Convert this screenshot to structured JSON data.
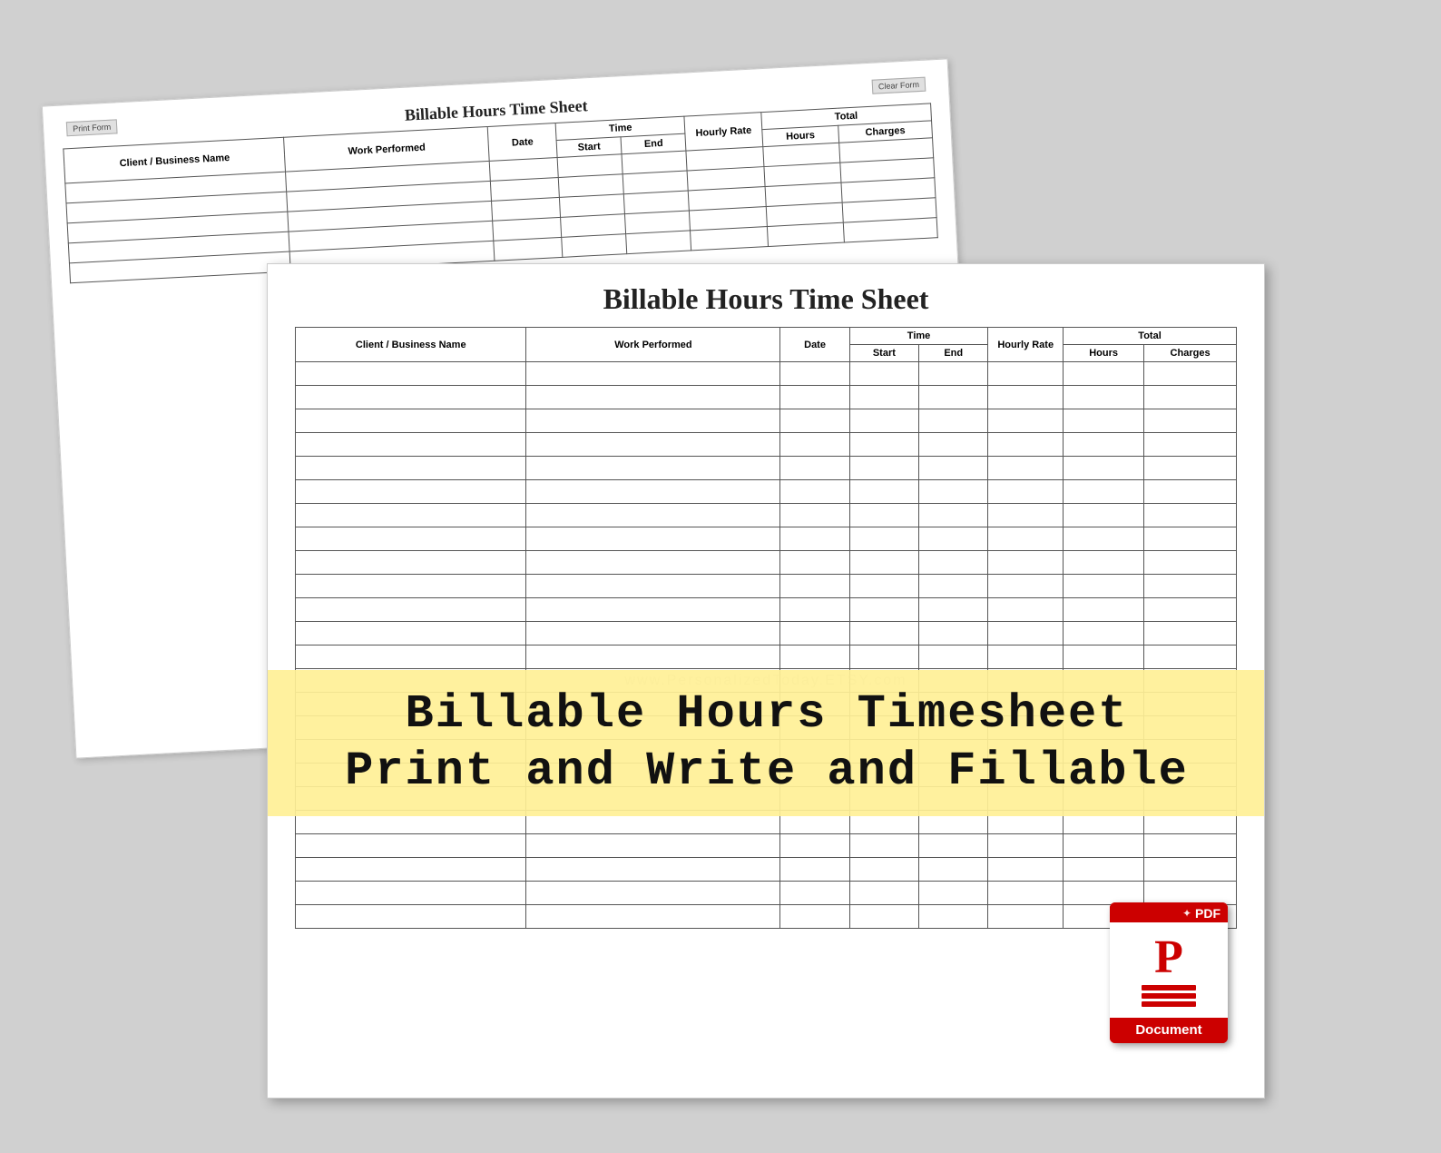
{
  "page": {
    "background_color": "#c8c8c8"
  },
  "back_sheet": {
    "title": "Billable Hours Time Sheet",
    "print_btn": "Print Form",
    "clear_btn": "Clear Form",
    "columns": {
      "client": "Client / Business Name",
      "work": "Work Performed",
      "date": "Date",
      "time_group": "Time",
      "time_start": "Start",
      "time_end": "End",
      "hourly": "Hourly Rate",
      "total_group": "Total",
      "total_hours": "Hours",
      "total_charges": "Charges"
    },
    "data_rows": 5
  },
  "front_sheet": {
    "title": "Billable Hours Time Sheet",
    "columns": {
      "client": "Client / Business Name",
      "work": "Work Performed",
      "date": "Date",
      "time_group": "Time",
      "time_start": "Start",
      "time_end": "End",
      "hourly": "Hourly Rate",
      "total_group": "Total",
      "total_hours": "Hours",
      "total_charges": "Charges"
    },
    "data_rows": 24
  },
  "banner": {
    "line1": "Billable Hours Timesheet",
    "line2": "Print and Write and Fillable"
  },
  "watermark": "www.PersonalizedToday.ETSY.com",
  "pdf_icon": {
    "symbol": "✦",
    "label": "PDF",
    "letter": "P",
    "footer": "Document"
  }
}
